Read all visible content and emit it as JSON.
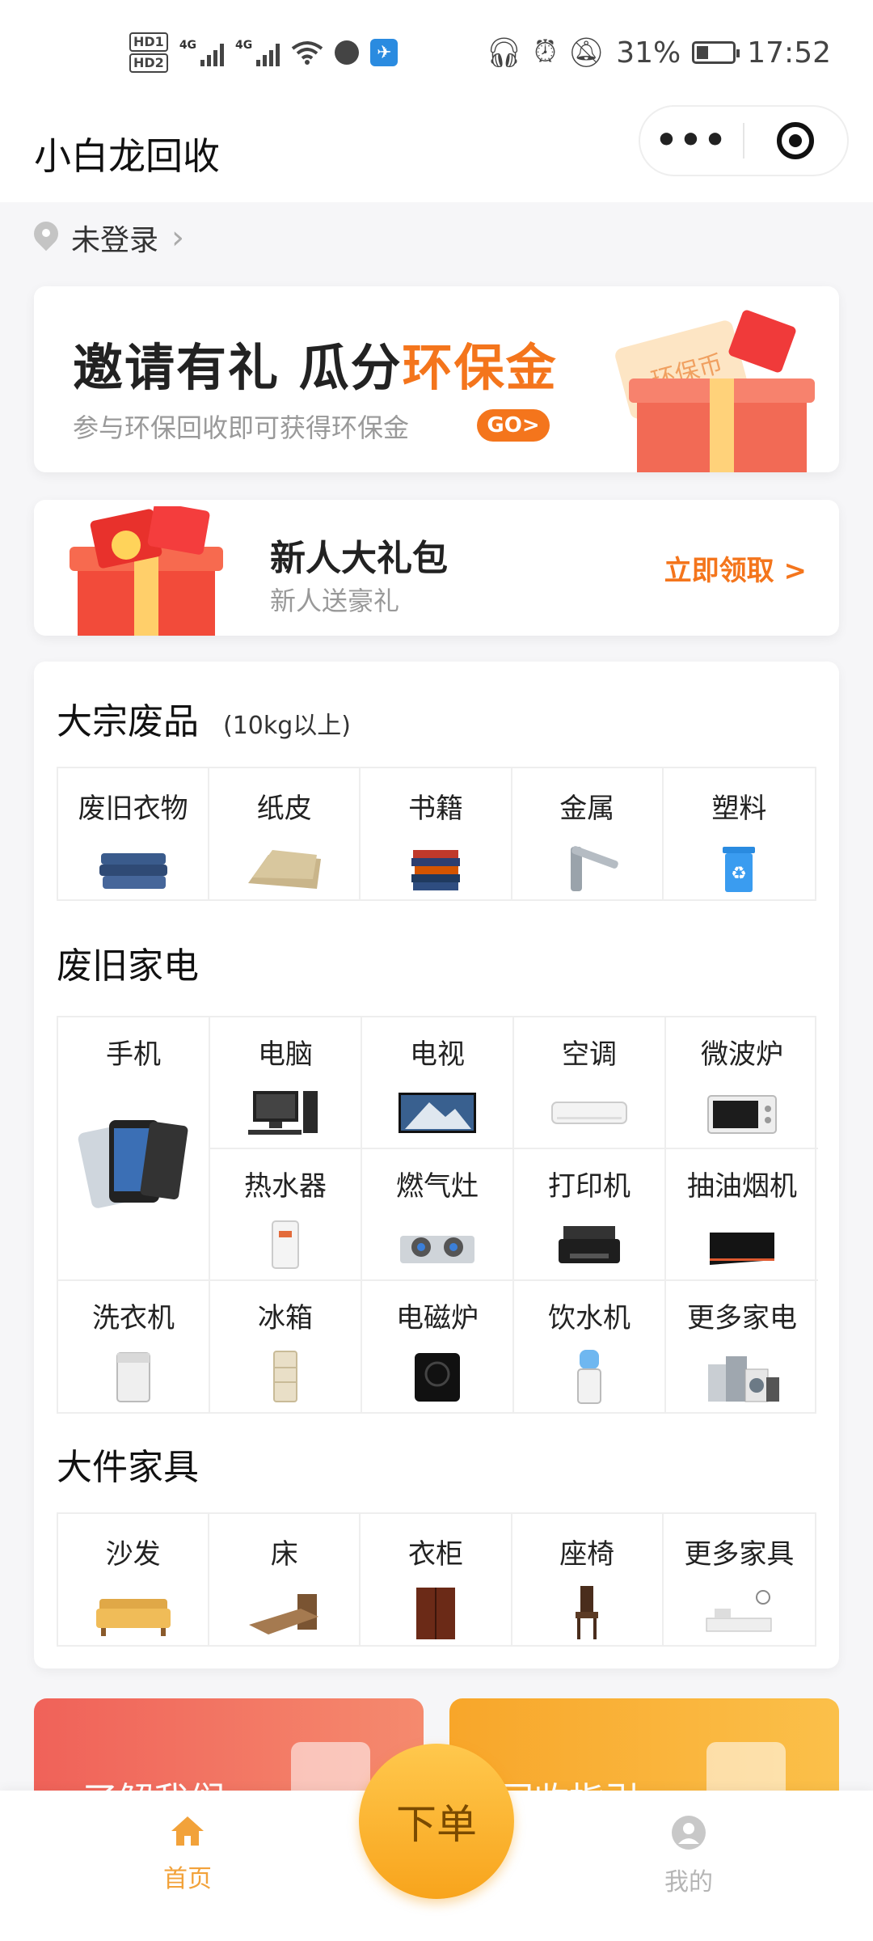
{
  "status_bar": {
    "hd1": "HD1",
    "hd2": "HD2",
    "net1": "4G",
    "net2": "4G",
    "battery": "31%",
    "time": "17:52"
  },
  "header": {
    "title": "小白龙回收",
    "more_label": "•••"
  },
  "location": {
    "login_text": "未登录"
  },
  "banner": {
    "title_main": "邀请有礼  瓜分",
    "title_highlight": "环保金",
    "subtitle": "参与环保回收即可获得环保金",
    "go_label": "GO>",
    "coin_text": "环保币"
  },
  "newbie": {
    "title": "新人大礼包",
    "subtitle": "新人送豪礼",
    "claim_label": "立即领取 >"
  },
  "sections": {
    "bulk": {
      "title": "大宗废品",
      "note": "(10kg以上)",
      "items": [
        "废旧衣物",
        "纸皮",
        "书籍",
        "金属",
        "塑料"
      ]
    },
    "appliances": {
      "title": "废旧家电",
      "items": [
        "手机",
        "电脑",
        "电视",
        "空调",
        "微波炉",
        "热水器",
        "燃气灶",
        "打印机",
        "抽油烟机",
        "洗衣机",
        "冰箱",
        "电磁炉",
        "饮水机",
        "更多家电"
      ]
    },
    "furniture": {
      "title": "大件家具",
      "items": [
        "沙发",
        "床",
        "衣柜",
        "座椅",
        "更多家具"
      ]
    }
  },
  "cards": {
    "about": "了解我们",
    "guide": "回收指引"
  },
  "tabbar": {
    "home": "首页",
    "order": "下单",
    "mine": "我的"
  },
  "colors": {
    "accent": "#f4751c",
    "fab": "#f8a41c",
    "card_left": "#f2645a",
    "card_right": "#f9b233"
  }
}
